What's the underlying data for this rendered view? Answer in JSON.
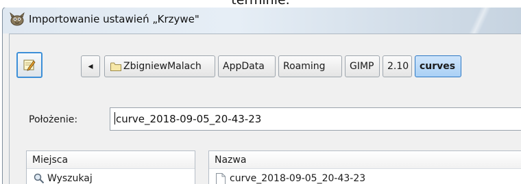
{
  "caption": "terminie.",
  "window": {
    "title": "Importowanie ustawień „Krzywe\"",
    "app_icon": "gimp-wilber-icon"
  },
  "toolbar": {
    "edit_icon": "pencil-note-icon",
    "back_arrow": "◂",
    "breadcrumbs": [
      "ZbigniewMalach",
      "AppData",
      "Roaming",
      "GIMP",
      "2.10",
      "curves"
    ],
    "active_crumb": "curves"
  },
  "location": {
    "label": "Położenie:",
    "value": "curve_2018-09-05_20-43-23"
  },
  "places": {
    "header": "Miejsca",
    "items": [
      {
        "label": "Wyszukaj",
        "icon": "search-icon"
      }
    ]
  },
  "files": {
    "header": "Nazwa",
    "items": [
      {
        "label": "curve_2018-09-05_20-43-23",
        "icon": "file-icon"
      }
    ]
  },
  "colors": {
    "accent": "#3c8fd8",
    "active_crumb_bg": "#b9dbfa",
    "titlebar": "#dfe8f1"
  }
}
